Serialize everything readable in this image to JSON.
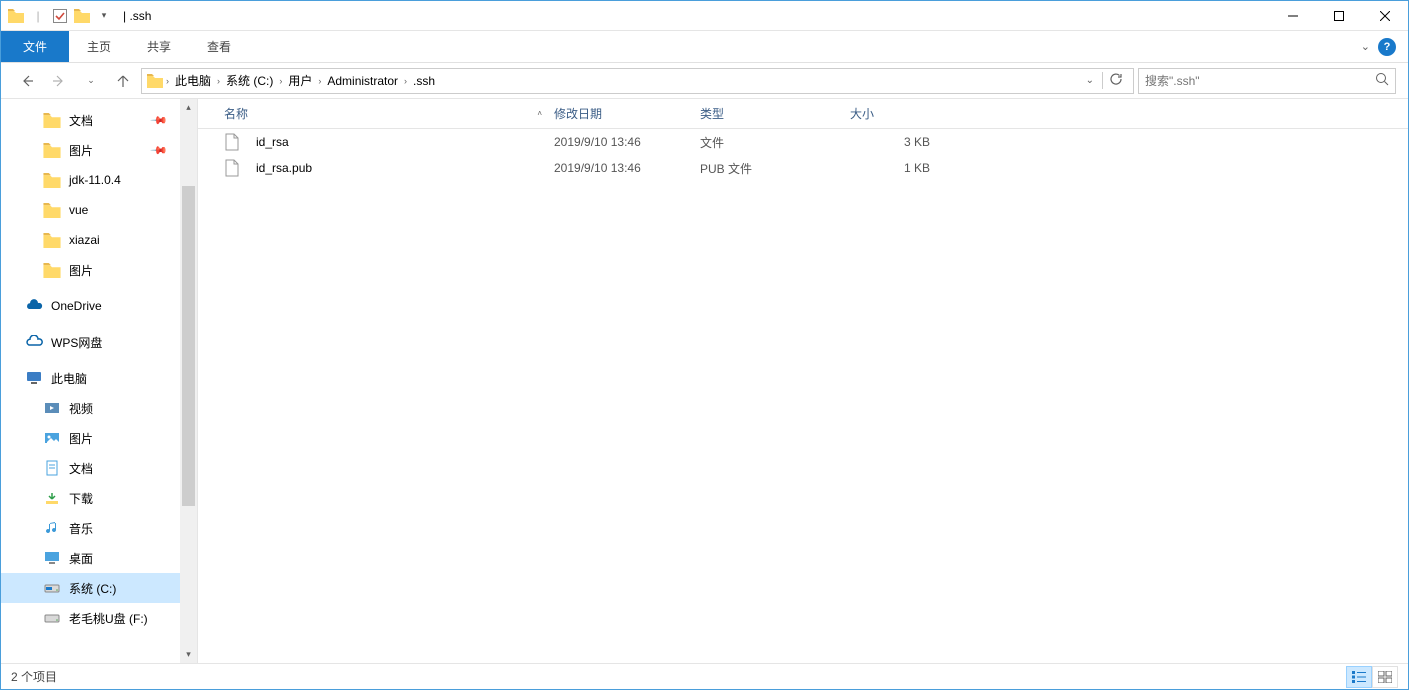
{
  "title": "| .ssh",
  "ribbon": {
    "file": "文件",
    "home": "主页",
    "share": "共享",
    "view": "查看"
  },
  "breadcrumbs": [
    "此电脑",
    "系统 (C:)",
    "用户",
    "Administrator",
    ".ssh"
  ],
  "search_placeholder": "搜索\".ssh\"",
  "columns": {
    "name": "名称",
    "date": "修改日期",
    "type": "类型",
    "size": "大小"
  },
  "files": [
    {
      "name": "id_rsa",
      "date": "2019/9/10 13:46",
      "type": "文件",
      "size": "3 KB"
    },
    {
      "name": "id_rsa.pub",
      "date": "2019/9/10 13:46",
      "type": "PUB 文件",
      "size": "1 KB"
    }
  ],
  "sidebar": {
    "quick": [
      {
        "label": "文档",
        "icon": "folder",
        "pinned": true
      },
      {
        "label": "图片",
        "icon": "folder",
        "pinned": true
      },
      {
        "label": "jdk-11.0.4",
        "icon": "folder"
      },
      {
        "label": "vue",
        "icon": "folder"
      },
      {
        "label": "xiazai",
        "icon": "folder"
      },
      {
        "label": "图片",
        "icon": "folder"
      }
    ],
    "onedrive": "OneDrive",
    "wps": "WPS网盘",
    "thispc": "此电脑",
    "pc_items": [
      {
        "label": "视频",
        "icon": "video"
      },
      {
        "label": "图片",
        "icon": "pictures"
      },
      {
        "label": "文档",
        "icon": "docs"
      },
      {
        "label": "下载",
        "icon": "downloads"
      },
      {
        "label": "音乐",
        "icon": "music"
      },
      {
        "label": "桌面",
        "icon": "desktop"
      },
      {
        "label": "系统 (C:)",
        "icon": "drive",
        "selected": true
      },
      {
        "label": "老毛桃U盘 (F:)",
        "icon": "usb"
      }
    ]
  },
  "status": "2 个项目"
}
